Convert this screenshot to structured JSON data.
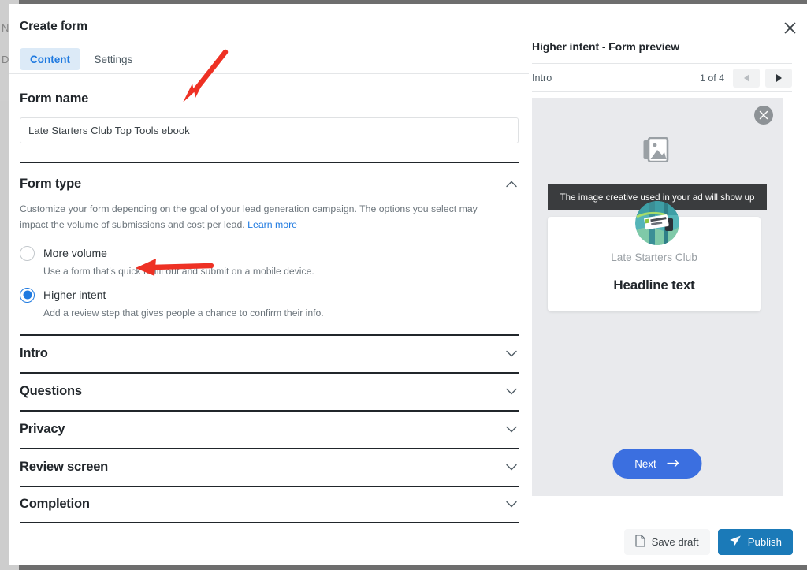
{
  "window": {
    "title": "Create form",
    "close_icon": "close-icon"
  },
  "tabs": [
    {
      "label": "Content",
      "active": true
    },
    {
      "label": "Settings",
      "active": false
    }
  ],
  "form_name": {
    "section_label": "Form name",
    "value": "Late Starters Club Top Tools ebook",
    "placeholder": "Form name"
  },
  "form_type": {
    "section_label": "Form type",
    "chevron_icon": "chevron-up-icon",
    "description": "Customize your form depending on the goal of your lead generation campaign. The options you select may impact the volume of submissions and cost per lead.",
    "learn_more_label": "Learn more",
    "options": [
      {
        "label": "More volume",
        "description": "Use a form that's quick to fill out and submit on a mobile device.",
        "selected": false
      },
      {
        "label": "Higher intent",
        "description": "Add a review step that gives people a chance to confirm their info.",
        "selected": true
      }
    ]
  },
  "accordion": [
    {
      "label": "Intro",
      "chevron_icon": "chevron-down-icon"
    },
    {
      "label": "Questions",
      "chevron_icon": "chevron-down-icon"
    },
    {
      "label": "Privacy",
      "chevron_icon": "chevron-down-icon"
    },
    {
      "label": "Review screen",
      "chevron_icon": "chevron-down-icon"
    },
    {
      "label": "Completion",
      "chevron_icon": "chevron-down-icon"
    }
  ],
  "preview": {
    "title": "Higher intent - Form preview",
    "step_label": "Intro",
    "counter": "1 of 4",
    "prev_icon": "triangle-left-icon",
    "next_icon": "triangle-right-icon",
    "close_icon": "close-circle-icon",
    "image_placeholder_icon": "image-placeholder-icon",
    "tooltip_text": "The image creative used in your ad will show up",
    "avatar_icon": "brand-avatar",
    "avatar_sign_text": "STARTERS CLUB",
    "brand_name": "Late Starters Club",
    "headline": "Headline text",
    "next_button_label": "Next",
    "next_button_icon": "arrow-right-icon"
  },
  "footer": {
    "save_draft_label": "Save draft",
    "save_draft_icon": "document-icon",
    "publish_label": "Publish",
    "publish_icon": "paper-plane-icon"
  },
  "annotations": [
    {
      "name": "arrow-to-form-name",
      "color": "#ee3124"
    },
    {
      "name": "arrow-to-higher-intent",
      "color": "#ee3124"
    }
  ],
  "background": {
    "glyph_1": "N",
    "glyph_2": "D"
  },
  "colors": {
    "accent_blue": "#1f7ae0",
    "next_blue": "#3b6fe0",
    "publish_blue": "#1b7ab8",
    "tooltip_dark": "#3a3c3e",
    "preview_bg": "#e9eaed",
    "annotation_red": "#ee3124"
  }
}
